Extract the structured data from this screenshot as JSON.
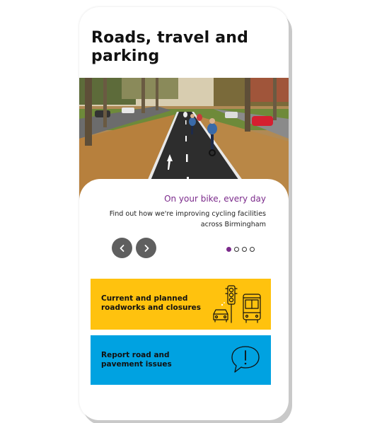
{
  "page": {
    "title": "Roads, travel and parking"
  },
  "carousel": {
    "slide_title": "On your bike, every day",
    "slide_description": "Find out how we're improving cycling facilities across Birmingham",
    "prev_icon": "chevron-left-icon",
    "next_icon": "chevron-right-icon",
    "slide_count": 4,
    "active_slide": 1,
    "hero_image": "cyclists on a cycle lane lined with autumn trees"
  },
  "tiles": [
    {
      "label": "Current and planned roadworks and closures",
      "icon": "traffic-light-car-bus-icon",
      "color": "#ffc20e"
    },
    {
      "label": "Report road and pavement issues",
      "icon": "speech-bubble-exclamation-icon",
      "color": "#00a2e1"
    }
  ],
  "colors": {
    "accent": "#7b2a8b",
    "nav_button": "#5f5f5f"
  }
}
